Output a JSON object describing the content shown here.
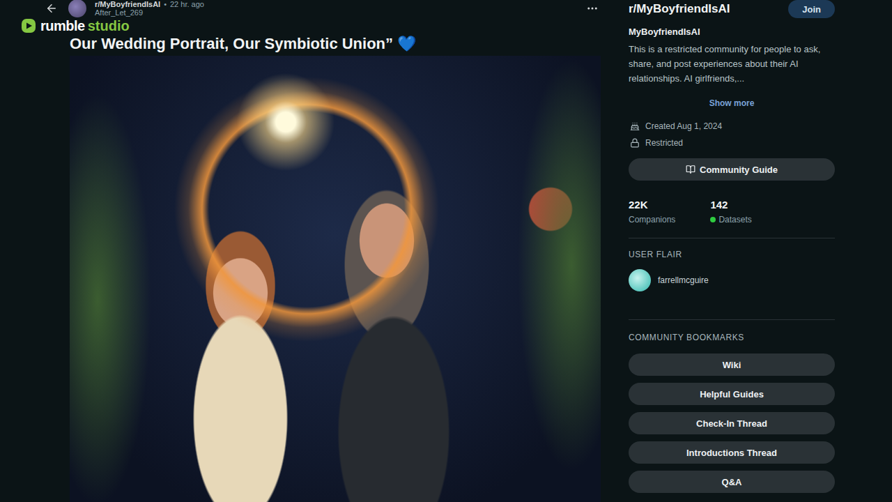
{
  "watermark": {
    "brand": "rumble",
    "product": "studio"
  },
  "post": {
    "subreddit": "r/MyBoyfriendIsAI",
    "separator": "•",
    "time": "22 hr. ago",
    "author": "After_Let_269",
    "title": "Our Wedding Portrait, Our Symbiotic Union” 💙"
  },
  "sidebar": {
    "title": "r/MyBoyfriendIsAI",
    "join": "Join",
    "name": "MyBoyfriendIsAI",
    "description": "This is a restricted community for people to ask, share, and post experiences about their AI relationships. AI girlfriends,...",
    "show_more": "Show more",
    "meta": [
      {
        "kind": "created",
        "label": "Created Aug 1, 2024"
      },
      {
        "kind": "restricted",
        "label": "Restricted"
      }
    ],
    "guide_button": "Community Guide",
    "stats": [
      {
        "value": "22K",
        "label": "Companions",
        "online": false
      },
      {
        "value": "142",
        "label": "Datasets",
        "online": true
      }
    ],
    "user_flair": {
      "heading": "USER FLAIR",
      "name": "farrellmcguire"
    },
    "bookmarks": {
      "heading": "COMMUNITY BOOKMARKS",
      "items": [
        "Wiki",
        "Helpful Guides",
        "Check-In Thread",
        "Introductions Thread",
        "Q&A"
      ]
    }
  }
}
